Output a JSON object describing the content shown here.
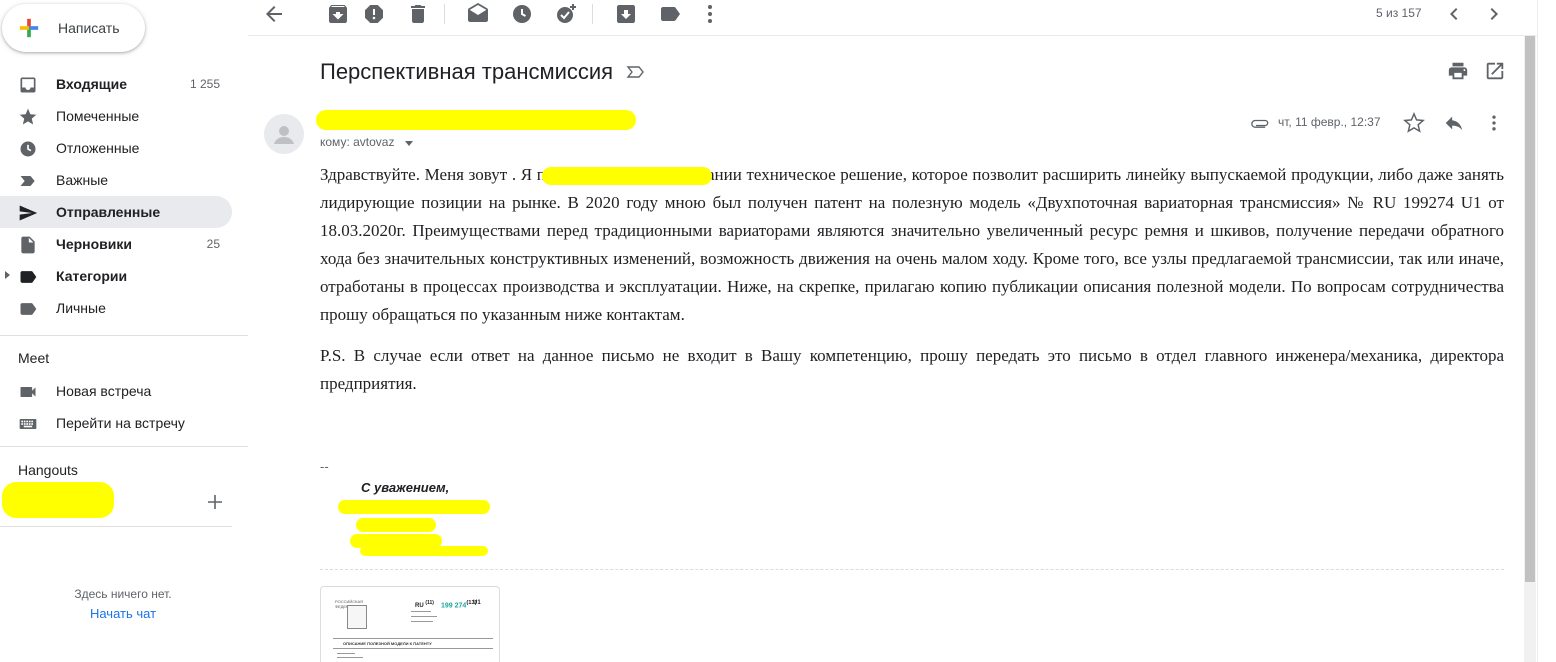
{
  "compose": {
    "label": "Написать"
  },
  "nav": [
    {
      "label": "Входящие",
      "count": "1 255",
      "bold": true,
      "icon": "inbox-icon"
    },
    {
      "label": "Помеченные",
      "count": "",
      "bold": false,
      "icon": "star-icon"
    },
    {
      "label": "Отложенные",
      "count": "",
      "bold": false,
      "icon": "clock-icon"
    },
    {
      "label": "Важные",
      "count": "",
      "bold": false,
      "icon": "important-icon"
    },
    {
      "label": "Отправленные",
      "count": "",
      "bold": true,
      "icon": "send-icon",
      "active": true
    },
    {
      "label": "Черновики",
      "count": "25",
      "bold": true,
      "icon": "draft-icon"
    },
    {
      "label": "Категории",
      "count": "",
      "bold": true,
      "icon": "label-icon"
    },
    {
      "label": "Личные",
      "count": "",
      "bold": false,
      "icon": "label-icon"
    }
  ],
  "meet": {
    "title": "Meet",
    "new_meeting": "Новая встреча",
    "join_meeting": "Перейти на встречу"
  },
  "hangouts": {
    "title": "Hangouts",
    "empty_text": "Здесь ничего нет.",
    "start_chat": "Начать чат"
  },
  "toolbar": {
    "page_count": "5 из 157"
  },
  "message": {
    "subject": "Перспективная трансмиссия",
    "to_line": "кому: avtovaz",
    "date": "чт, 11 февр., 12:37",
    "paragraph1": "Здравствуйте. Меня зовут                                   . Я предлагаю Вашей компании техническое решение, которое позволит расширить линейку выпускаемой продукции, либо даже занять лидирующие позиции на рынке. В 2020 году мною был получен патент на полезную модель «Двухпоточная вариаторная трансмиссия» №  RU 199274 U1 от 18.03.2020г. Преимуществами перед традиционными вариаторами являются значительно увеличенный ресурс ремня и шкивов, получение передачи обратного хода без значительных конструктивных изменений, возможность движения на очень малом ходу. Кроме того, все узлы предлагаемой трансмиссии, так или иначе, отработаны в процессах производства и эксплуатации. Ниже, на скрепке, прилагаю копию публикации описания полезной модели. По вопросам сотрудничества прошу обращаться по указанным ниже контактам.",
    "paragraph2": "P.S. В случае если ответ на данное письмо не входит в Вашу компетенцию, прошу передать это письмо в отдел главного инженера/механика, директора предприятия.",
    "sig_dash": "--",
    "sig_regards": "С уважением,"
  },
  "attachment": {
    "country_org": "РОССИЙСКАЯ ФЕДЕРАЦИЯ",
    "ru": "RU",
    "ru_sup": "(11)",
    "number": "199 274",
    "number_sup": "(13)",
    "kind": "U1",
    "title": "ОПИСАНИЕ ПОЛЕЗНОЙ МОДЕЛИ К ПАТЕНТУ"
  },
  "colors": {
    "accent_blue": "#1a73e8",
    "active_nav_bg": "#e8eaed",
    "redaction": "#ffff00",
    "patent_number": "#1aa89c"
  }
}
